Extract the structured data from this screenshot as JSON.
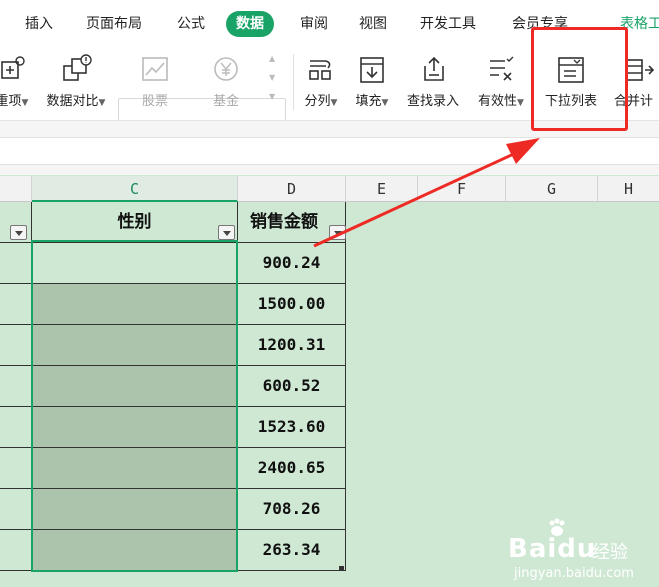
{
  "tabs": [
    {
      "label": "插入"
    },
    {
      "label": "页面布局"
    },
    {
      "label": "公式"
    },
    {
      "label": "数据"
    },
    {
      "label": "审阅"
    },
    {
      "label": "视图"
    },
    {
      "label": "开发工具"
    },
    {
      "label": "会员专享"
    },
    {
      "label": "表格工"
    }
  ],
  "ribbon": {
    "items": [
      {
        "label": "重项",
        "icon": "duplicate-icon"
      },
      {
        "label": "数据对比",
        "icon": "compare-icon"
      },
      {
        "label": "股票",
        "icon": "stock-chart-icon"
      },
      {
        "label": "基金",
        "icon": "fund-yen-icon"
      },
      {
        "label": "分列",
        "icon": "split-column-icon"
      },
      {
        "label": "填充",
        "icon": "fill-down-icon"
      },
      {
        "label": "查找录入",
        "icon": "lookup-entry-icon"
      },
      {
        "label": "有效性",
        "icon": "validation-icon"
      },
      {
        "label": "下拉列表",
        "icon": "dropdown-list-icon"
      },
      {
        "label": "合并计",
        "icon": "consolidate-icon"
      }
    ]
  },
  "columns": [
    "C",
    "D",
    "E",
    "F",
    "G",
    "H"
  ],
  "sheet": {
    "headers": {
      "c": "性别",
      "d": "销售金额"
    },
    "values": [
      "900.24",
      "1500.00",
      "1200.31",
      "600.52",
      "1523.60",
      "2400.65",
      "708.26",
      "263.34"
    ]
  },
  "watermark": {
    "brand": "Baidu",
    "sub": "经验",
    "url": "jingyan.baidu.com"
  },
  "colors": {
    "accent": "#1aa367",
    "annotation": "#ee2a24",
    "sheet_bg": "#cfe8d3",
    "selection_fill": "#acc4ac"
  }
}
